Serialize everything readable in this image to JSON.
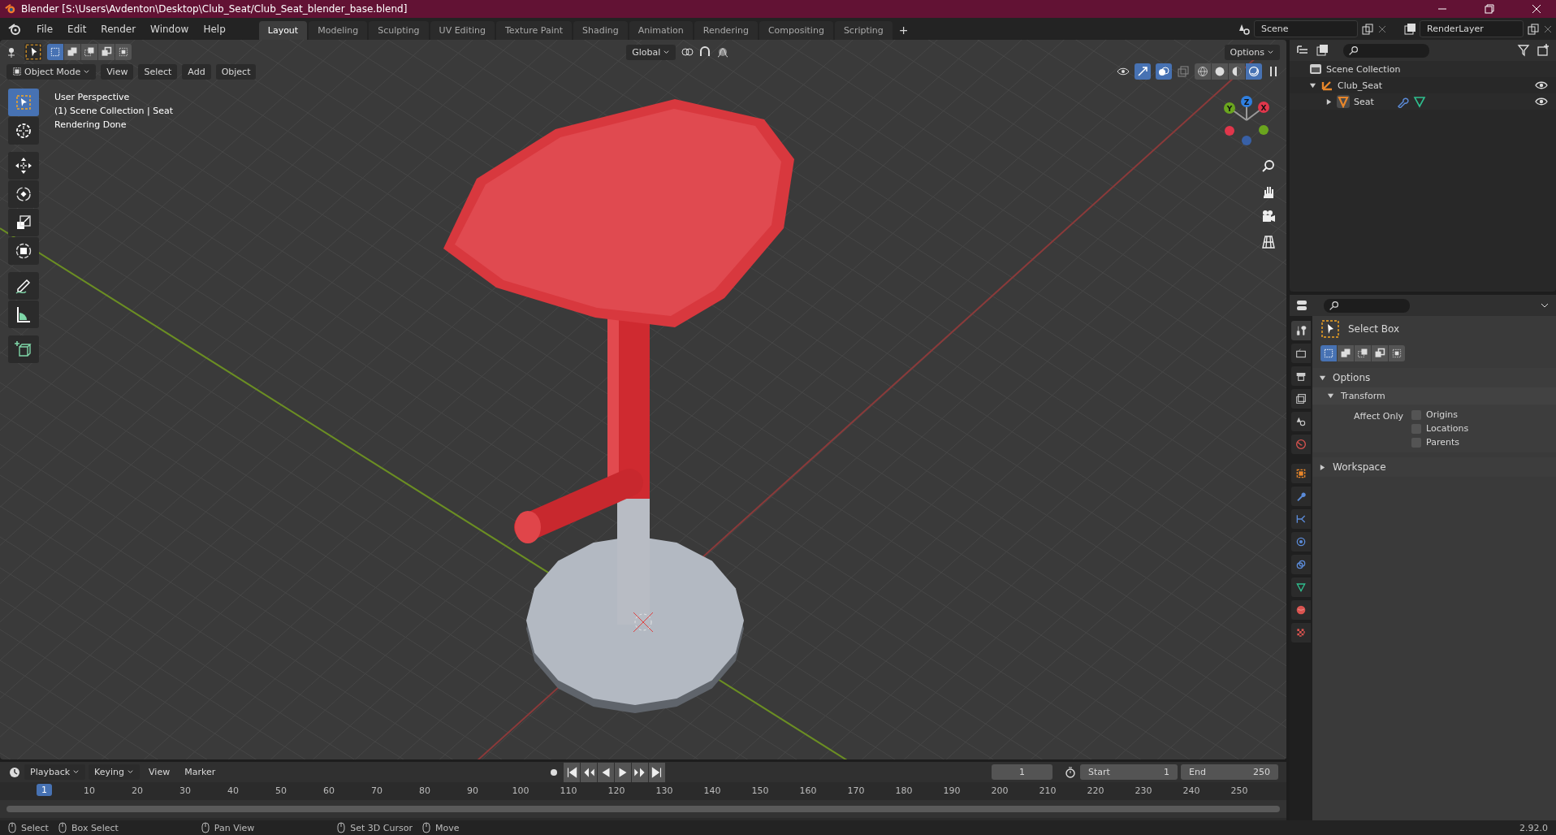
{
  "window": {
    "title": "Blender [S:\\Users\\Avdenton\\Desktop\\Club_Seat/Club_Seat_blender_base.blend]"
  },
  "menu": [
    "File",
    "Edit",
    "Render",
    "Window",
    "Help"
  ],
  "workspaces": [
    {
      "label": "Layout",
      "selected": true
    },
    {
      "label": "Modeling",
      "selected": false
    },
    {
      "label": "Sculpting",
      "selected": false
    },
    {
      "label": "UV Editing",
      "selected": false
    },
    {
      "label": "Texture Paint",
      "selected": false
    },
    {
      "label": "Shading",
      "selected": false
    },
    {
      "label": "Animation",
      "selected": false
    },
    {
      "label": "Rendering",
      "selected": false
    },
    {
      "label": "Compositing",
      "selected": false
    },
    {
      "label": "Scripting",
      "selected": false
    }
  ],
  "add_workspace": "+",
  "scene": {
    "scene": "Scene",
    "view_layer": "RenderLayer"
  },
  "viewport": {
    "select_modes": [
      {
        "selected": true
      },
      {
        "selected": false
      },
      {
        "selected": false
      },
      {
        "selected": false
      },
      {
        "selected": false
      }
    ],
    "orientation": "Global",
    "options": "Options",
    "mode": "Object Mode",
    "menus": [
      "View",
      "Select",
      "Add",
      "Object"
    ],
    "shading": [
      {
        "selected": false
      },
      {
        "selected": false
      },
      {
        "selected": false
      },
      {
        "selected": true
      }
    ],
    "info": [
      "User Perspective",
      "(1) Scene Collection | Seat",
      "Rendering Done"
    ],
    "tools": [
      {
        "selected": true
      },
      {
        "selected": false
      },
      {
        "selected": false
      },
      {
        "selected": false
      },
      {
        "selected": false
      },
      {
        "selected": false
      },
      {
        "selected": false
      },
      {
        "selected": false
      },
      {
        "selected": false
      }
    ],
    "gizmo": {
      "z": "Z",
      "y": "Y",
      "x": "X"
    }
  },
  "outliner": {
    "root": "Scene Collection",
    "children": [
      {
        "label": "Club_Seat",
        "expanded": true,
        "visible": true,
        "children": [
          {
            "label": "Seat",
            "expanded": false,
            "visible": true
          }
        ]
      }
    ]
  },
  "properties": {
    "tabs": [
      {
        "selected": true
      },
      {
        "selected": false
      },
      {
        "selected": false
      },
      {
        "selected": false
      },
      {
        "selected": false
      },
      {
        "selected": false
      },
      {
        "selected": false
      },
      {
        "selected": false
      },
      {
        "selected": false
      },
      {
        "selected": false
      },
      {
        "selected": false
      },
      {
        "selected": false
      },
      {
        "selected": false
      },
      {
        "selected": false
      }
    ],
    "tool": "Select Box",
    "select_modes": [
      {
        "selected": true
      },
      {
        "selected": false
      },
      {
        "selected": false
      },
      {
        "selected": false
      },
      {
        "selected": false
      }
    ],
    "options": {
      "label": "Options",
      "expanded": true
    },
    "transform": {
      "label": "Transform",
      "expanded": true
    },
    "affect_only": "Affect Only",
    "checkboxes": [
      {
        "label": "Origins",
        "checked": false
      },
      {
        "label": "Locations",
        "checked": false
      },
      {
        "label": "Parents",
        "checked": false
      }
    ],
    "workspace": {
      "label": "Workspace",
      "expanded": false
    }
  },
  "timeline": {
    "menus": [
      "Playback",
      "Keying",
      "View",
      "Marker"
    ],
    "current_frame": "1",
    "start_label": "Start",
    "start": "1",
    "end_label": "End",
    "end": "250",
    "playhead": "1",
    "ruler": [
      "10",
      "20",
      "30",
      "40",
      "50",
      "60",
      "70",
      "80",
      "90",
      "100",
      "110",
      "120",
      "130",
      "140",
      "150",
      "160",
      "170",
      "180",
      "190",
      "200",
      "210",
      "220",
      "230",
      "240",
      "250"
    ]
  },
  "status_bar": {
    "hints": [
      "Select",
      "Box Select",
      "Pan View",
      "Set 3D Cursor",
      "Move"
    ],
    "version": "2.92.0"
  }
}
